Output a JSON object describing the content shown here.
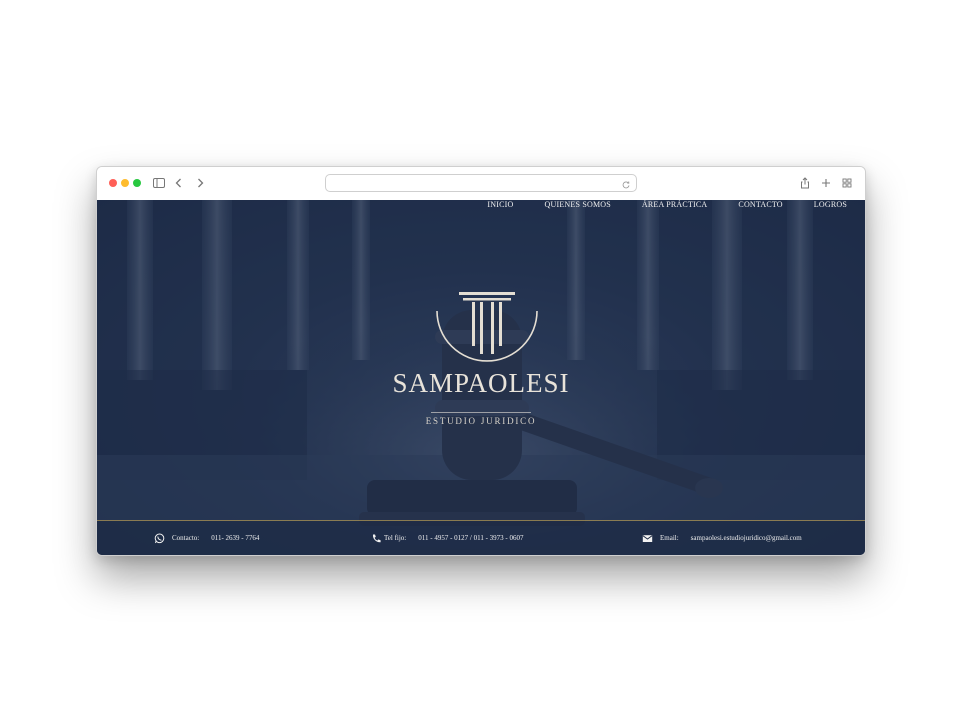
{
  "browser": {
    "url": "",
    "icons": [
      "sidebar-icon",
      "chevron-left-icon",
      "chevron-right-icon",
      "reload-icon",
      "share-icon",
      "plus-icon",
      "tabs-grid-icon"
    ]
  },
  "nav": {
    "items": [
      "INICIO",
      "QUIENES SOMOS",
      "ÁREA PRÁCTICA",
      "CONTACTO",
      "LOGROS"
    ]
  },
  "hero": {
    "brand": "SAMPAOLESI",
    "tagline": "ESTUDIO JURIDICO"
  },
  "footer": {
    "contact_label": "Contacto:",
    "contact_value": "011- 2639 - 7764",
    "phone_label": "Tel fijo:",
    "phone_value": "011 - 4957 - 0127 / 011 - 3973 - 0607",
    "email_label": "Email:",
    "email_value": "sampaolesi.estudiojuridico@gmail.com"
  },
  "colors": {
    "overlay": "#1c2d4e",
    "text_light": "#e8e3da",
    "accent_gold": "#b59a52",
    "traffic_red": "#ff5f57",
    "traffic_yellow": "#febc2e",
    "traffic_green": "#28c840"
  }
}
